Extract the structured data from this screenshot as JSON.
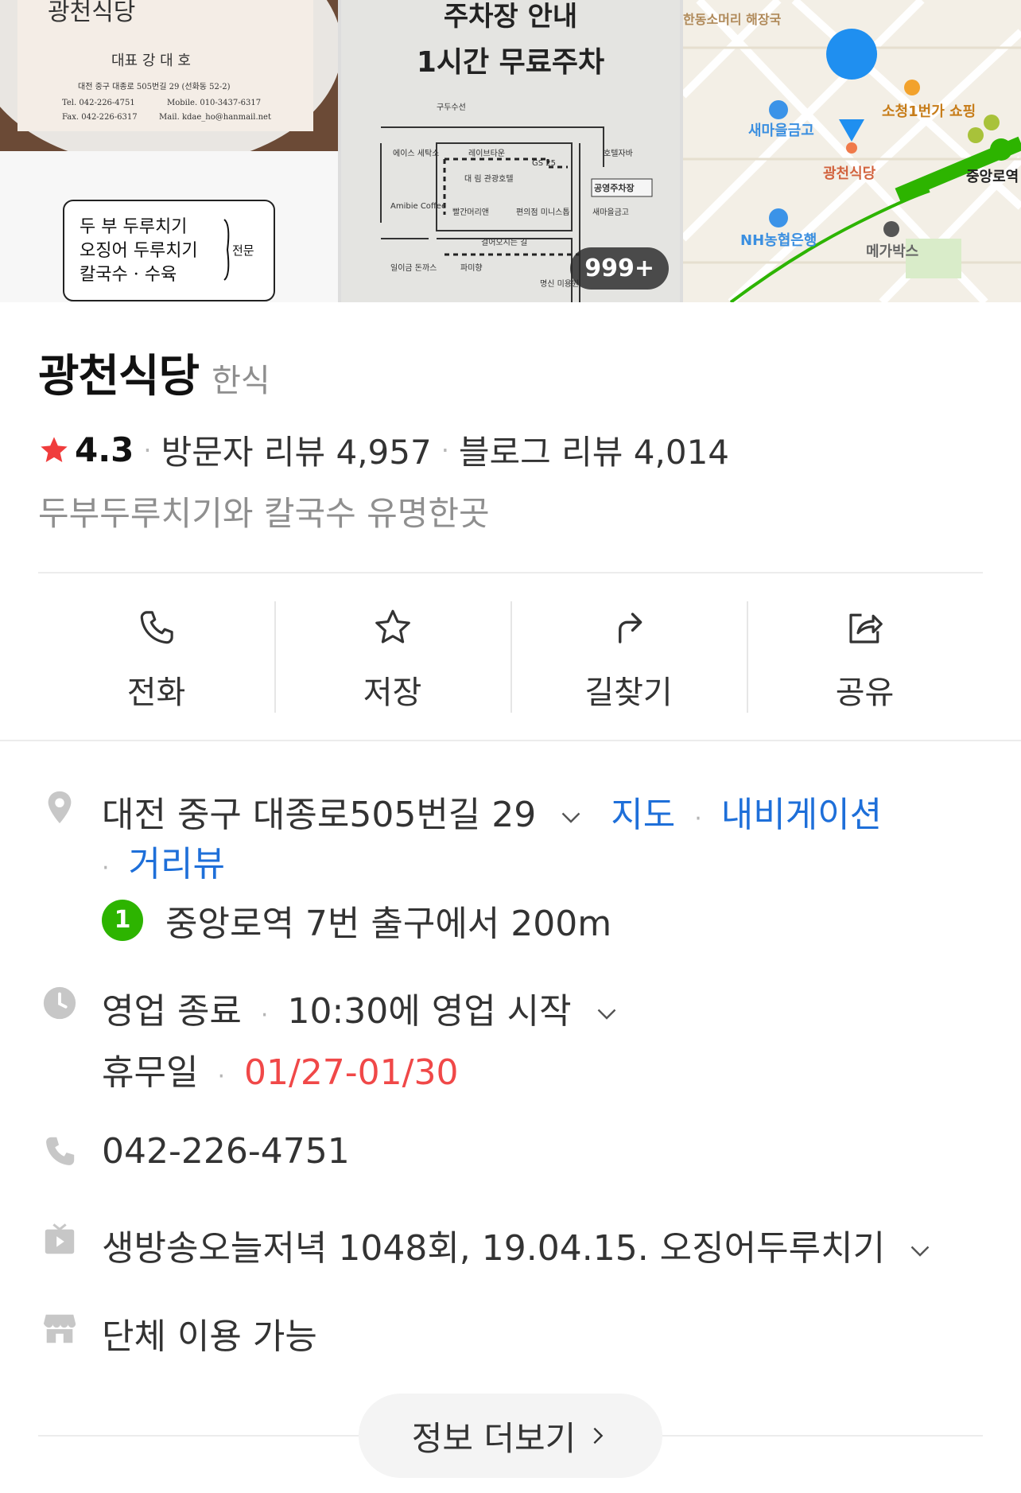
{
  "photos": {
    "card_name": "광천식당",
    "card_owner": "대표 강 대 호",
    "card_address": "대전 중구 대종로 505번길 29 (선화동 52-2)",
    "card_tel": "Tel. 042-226-4751",
    "card_mobile": "Mobile. 010-3437-6317",
    "card_fax": "Fax. 042-226-6317",
    "card_mail": "Mail. kdae_ho@hanmail.net",
    "menu_line1": "두  부 두루치기",
    "menu_line2": "오징어 두루치기",
    "menu_line3": "칼국수 · 수육",
    "menu_specialty": "전문",
    "parking_title": "주차장 안내",
    "parking_subtitle": "1시간 무료주차",
    "parking_labels": [
      "구두수선",
      "에이스 세탁소",
      "레이브타운",
      "GS 25",
      "호텔자바",
      "대 림 관광호텔",
      "공영주차장",
      "Amibie Coffee",
      "빨간머리앤",
      "편의점 미니스톱",
      "새마을금고",
      "걸어오시는 길",
      "일이금 돈까스",
      "파미향",
      "명신 미용원"
    ],
    "photo_count": "999+",
    "map_labels": {
      "top_left": "한동소머리 해장국",
      "bank1": "새마을금고",
      "shopping": "소청1번가 쇼핑",
      "restaurant": "광천식당",
      "station": "중앙로역",
      "bank2": "NH농협은행",
      "cafe": "메가박스"
    }
  },
  "place": {
    "name": "광천식당",
    "category": "한식",
    "rating": "4.3",
    "visitor_reviews": "방문자 리뷰 4,957",
    "blog_reviews": "블로그 리뷰 4,014",
    "tagline": "두부두루치기와 칼국수 유명한곳"
  },
  "actions": [
    {
      "label": "전화",
      "icon": "phone-icon"
    },
    {
      "label": "저장",
      "icon": "star-icon"
    },
    {
      "label": "길찾기",
      "icon": "directions-icon"
    },
    {
      "label": "공유",
      "icon": "share-icon"
    }
  ],
  "info": {
    "address": "대전 중구 대종로505번길 29",
    "map_link": "지도",
    "nav_link": "내비게이션",
    "street_link": "거리뷰",
    "subway_line": "1",
    "subway_text": "중앙로역 7번 출구에서 200m",
    "hours_status": "영업 종료",
    "hours_next": "10:30에 영업 시작",
    "holiday_label": "휴무일",
    "holiday_dates": "01/27-01/30",
    "phone": "042-226-4751",
    "tv": "생방송오늘저녁 1048회, 19.04.15. 오징어두루치기",
    "group": "단체 이용 가능"
  },
  "more_button": "정보 더보기",
  "colors": {
    "star": "#f03c3c",
    "link_blue": "#1e6fd9",
    "holiday_red": "#f04848",
    "subway_green": "#2db400",
    "icon_gray": "#c7c7c7"
  }
}
